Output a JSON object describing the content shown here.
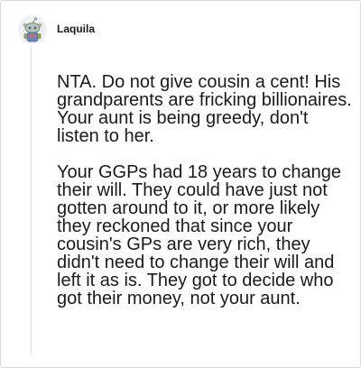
{
  "comment": {
    "author": "Laquila",
    "avatar_icon": "snoo-avatar-icon",
    "paragraphs": [
      "NTA. Do not give cousin a cent! His grandparents are fricking billionaires. Your aunt is being greedy, don't listen to her.",
      "Your GGPs had 18 years to change their will. They could have just not gotten around to it, or more likely they reckoned that since your cousin's GPs are very rich, they didn't need to change their will and left it as is. They got to decide who got their money, not your aunt."
    ]
  },
  "colors": {
    "text": "#1a1a1b",
    "border": "#d9d9d9",
    "thread_line": "#dcdcdc"
  }
}
